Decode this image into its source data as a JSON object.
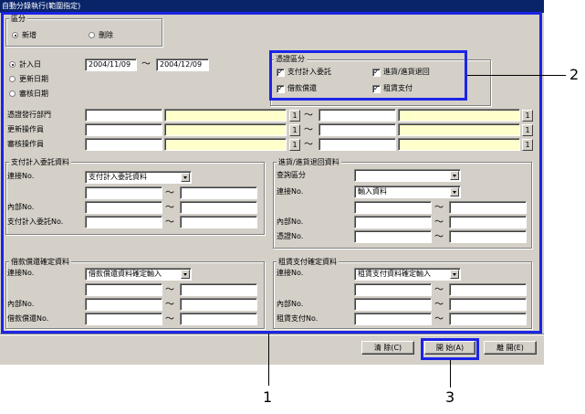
{
  "window": {
    "title": "自動分錄執行(範圍指定)"
  },
  "section_kubun": {
    "legend": "區分",
    "options": [
      {
        "label": "新增",
        "selected": true
      },
      {
        "label": "刪除",
        "selected": false
      }
    ]
  },
  "date_type": {
    "options": [
      {
        "label": "計入日",
        "selected": true
      },
      {
        "label": "更新日期",
        "selected": false
      },
      {
        "label": "審核日期",
        "selected": false
      }
    ],
    "from": "2004/11/09",
    "to": "2004/12/09",
    "tilde": "～"
  },
  "voucher_type": {
    "legend": "憑證區分",
    "items": [
      {
        "label": "支付計入委託",
        "checked": true
      },
      {
        "label": "進貨/進貨退回",
        "checked": true
      },
      {
        "label": "借款償還",
        "checked": true
      },
      {
        "label": "租賃支付",
        "checked": true
      }
    ]
  },
  "range_rows": [
    {
      "label": "憑證發行部門"
    },
    {
      "label": "更新操作員"
    },
    {
      "label": "審核操作員"
    }
  ],
  "search_btn_label": "1",
  "tilde": "～",
  "payment_group": {
    "legend": "支付計入委託資料",
    "link_label": "連接No.",
    "link_value": "支付計入委託資料",
    "internal_label": "內部No.",
    "number_label": "支付計入委託No."
  },
  "purchase_group": {
    "legend": "進貨/進貨退回資料",
    "query_label": "查詢區分",
    "query_value": "",
    "link_label": "連接No.",
    "link_value": "輸入資料",
    "internal_label": "內部No.",
    "number_label": "憑證No."
  },
  "loan_group": {
    "legend": "借款償還確定資料",
    "link_label": "連接No.",
    "link_value": "借款償還資料確定輸入",
    "internal_label": "內部No.",
    "number_label": "借款償還No."
  },
  "lease_group": {
    "legend": "租賃支付確定資料",
    "link_label": "連接No.",
    "link_value": "租賃支付資料確定輸入",
    "internal_label": "內部No.",
    "number_label": "租賃支付No."
  },
  "buttons": {
    "clear": "清 除(C)",
    "start": "開 始(A)",
    "close": "離 開(E)"
  },
  "callouts": {
    "one": "1",
    "two": "2",
    "three": "3"
  },
  "colors": {
    "highlight": "#1c24e6",
    "title_bar": "#0a246a",
    "dialog_bg": "#d4d0c8",
    "yellow_field": "#ffffcc"
  }
}
